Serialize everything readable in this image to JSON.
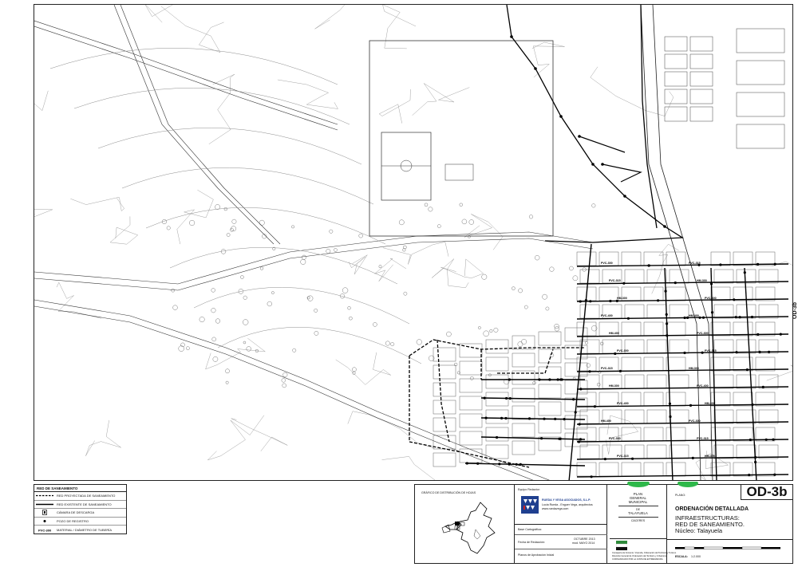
{
  "sheet": {
    "code": "OD-3b",
    "side_tab": "OD-3b",
    "plano_label": "PLANO:",
    "title": "ORDENACIÓN DETALLADA",
    "subtitle1": "INFRAESTRUCTURAS:",
    "subtitle2": "RED DE SANEAMIENTO.",
    "subtitle3": "Núcleo: Talayuela",
    "scale_label": "ESCALA:",
    "scale_value": "1:2.000"
  },
  "plan": {
    "line1": "PLAN",
    "line2": "GENERAL",
    "line3": "MUNICIPAL",
    "de": "DE",
    "town": "TALAYUELA",
    "province": "CÁCERES"
  },
  "legend": {
    "title": "RED DE SANEAMIENTO",
    "items": [
      {
        "label": "RED PROYECTADA DE SANEAMIENTO",
        "symbol": "dashed-line"
      },
      {
        "label": "RED EXISTENTE DE SANEAMIENTO",
        "symbol": "solid-line"
      },
      {
        "label": "CÁMARA DE DESCARGA",
        "symbol": "square"
      },
      {
        "label": "POZO DE REGISTRO",
        "symbol": "dot"
      },
      {
        "label": "MATERIAL / DIÁMETRO DE TUBERÍA",
        "symbol": "pipe-label"
      }
    ],
    "pipe_label_sample": "PVC-300"
  },
  "distribution": {
    "title": "GRÁFICO DE DISTRIBUCIÓN DE HOJAS"
  },
  "team": {
    "label": "Equipo Redactor:",
    "company": "RUEDA Y VEGA ASOCIADOS, S.L.P.",
    "architects": "Lucia Rueda - Enguer Vega, arquitectos",
    "web": "www.ruedavega.com"
  },
  "dates": {
    "base_label": "Base Cartográfica:",
    "redaction_label": "Fecha de Redacción:",
    "redaction_value1": "OCTUBRE 2013",
    "redaction_value2": "mod. MAYO 2014",
    "approval_label": "Planos de Aprobación Inicial"
  },
  "junta": {
    "line1": "Consejería de Fomento, Vivienda, Ordenación del Territorio y Turismo",
    "line2": "Dirección General de Ordenación del Territorio y Urbanismo",
    "line3": "COFINANCIADO POR LA JUNTA DE EXTREMADURA"
  },
  "map": {
    "colors": {
      "line": "#000000",
      "light": "#8c8c8c",
      "paper": "#ffffff"
    },
    "pipe_labels": [
      "PVC-300",
      "PVC-315",
      "HM-300",
      "PVC-400",
      "HM-400"
    ]
  }
}
